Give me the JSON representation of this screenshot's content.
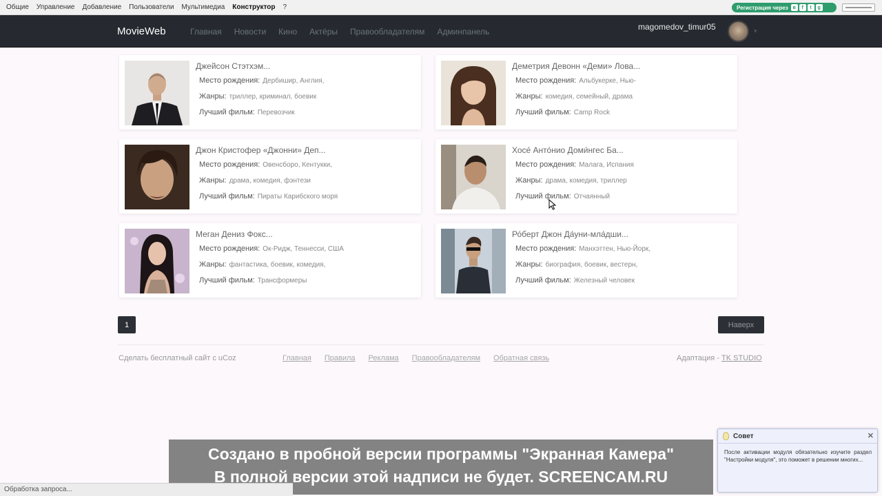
{
  "adminbar": {
    "menu": [
      {
        "label": "Общие"
      },
      {
        "label": "Управление"
      },
      {
        "label": "Добавление"
      },
      {
        "label": "Пользователи"
      },
      {
        "label": "Мультимедиа"
      },
      {
        "label": "Конструктор"
      },
      {
        "label": "?"
      }
    ],
    "register_label": "Регистрация через"
  },
  "navbar": {
    "brand": "MovieWeb",
    "items": [
      {
        "label": "Главная"
      },
      {
        "label": "Новости"
      },
      {
        "label": "Кино"
      },
      {
        "label": "Актёры"
      },
      {
        "label": "Правообладателям"
      },
      {
        "label": "Админпанель"
      }
    ],
    "username": "magomedov_timur05"
  },
  "labels": {
    "birthplace": "Место рождения:",
    "genres": "Жанры:",
    "best_film": "Лучший фильм:"
  },
  "actors": [
    {
      "name": "Джейсон Стэтхэм...",
      "birthplace": "Дербишир, Англия,",
      "genres": "триллер, криминал, боевик",
      "best_film": "Перевозчик"
    },
    {
      "name": "Деметрия Девонн «Деми» Лова...",
      "birthplace": "Альбукерке, Нью-",
      "genres": "комедия, семейный, драма",
      "best_film": "Camp Rock"
    },
    {
      "name": "Джон Кристофер «Джонни» Деп...",
      "birthplace": "Овенсборо, Кентукки,",
      "genres": "драма, комедия, фэнтези",
      "best_film": "Пираты Карибского моря"
    },
    {
      "name": "Хосе́ Анто́нио Доми́нгес Ба...",
      "birthplace": "Малага, Испания",
      "genres": "драма, комедия, триллер",
      "best_film": "Отчаянный"
    },
    {
      "name": "Меган Дениз Фокс...",
      "birthplace": "Ок-Ридж, Теннесси, США",
      "genres": "фантастика, боевик, комедия,",
      "best_film": "Трансформеры"
    },
    {
      "name": "Ро́берт Джон Да́уни-мла́дши...",
      "birthplace": "Манхэттен, Нью-Йорк,",
      "genres": "биография, боевик, вестерн,",
      "best_film": "Железный человек"
    }
  ],
  "pagination": {
    "current": "1",
    "up_label": "Наверх"
  },
  "footer": {
    "left": "Сделать бесплатный сайт с uCoz",
    "links": [
      {
        "label": "Главная"
      },
      {
        "label": "Правила"
      },
      {
        "label": "Реклама"
      },
      {
        "label": "Правообладателям"
      },
      {
        "label": "Обратная связь"
      }
    ],
    "adaptation": "Адаптация -",
    "studio": "TK STUDIO"
  },
  "watermark": {
    "line1": "Создано в пробной версии программы \"Экранная Камера\"",
    "line2": "В полной версии этой надписи не будет. SCREENCAM.RU"
  },
  "status": "Обработка запроса...",
  "tip": {
    "title": "Совет",
    "text": "После активации модуля обязательно изучите раздел \"Настройки модуля\", это поможет в решении многих..."
  }
}
